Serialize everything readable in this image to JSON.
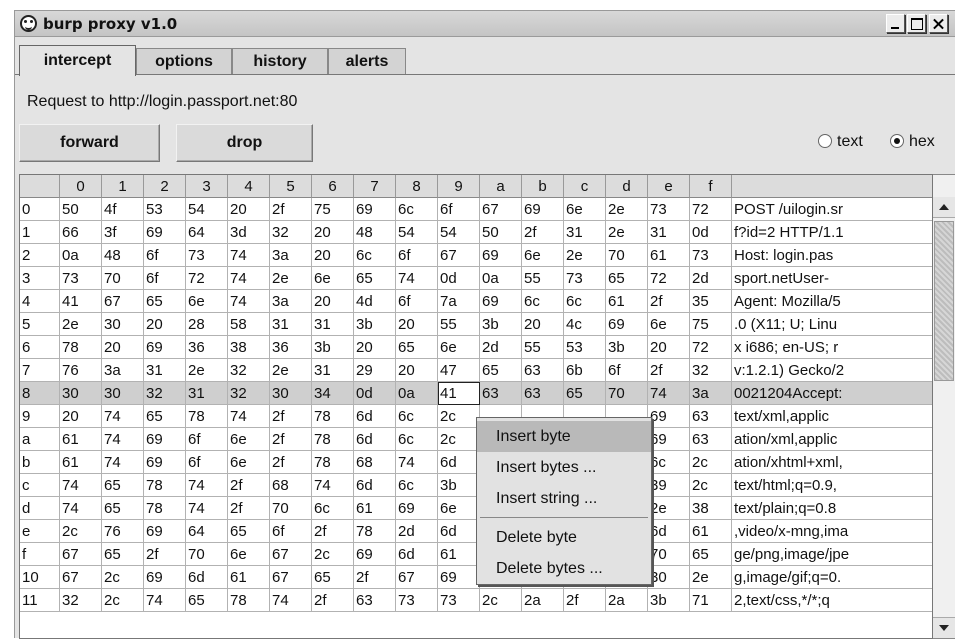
{
  "window": {
    "title": "burp proxy v1.0"
  },
  "tabs": [
    {
      "label": "intercept",
      "active": true
    },
    {
      "label": "options",
      "active": false
    },
    {
      "label": "history",
      "active": false
    },
    {
      "label": "alerts",
      "active": false
    }
  ],
  "request_label": "Request to http://login.passport.net:80",
  "buttons": {
    "forward": "forward",
    "drop": "drop"
  },
  "view_mode": {
    "text_label": "text",
    "hex_label": "hex",
    "selected": "hex"
  },
  "grid": {
    "columns": [
      "",
      "0",
      "1",
      "2",
      "3",
      "4",
      "5",
      "6",
      "7",
      "8",
      "9",
      "a",
      "b",
      "c",
      "d",
      "e",
      "f",
      ""
    ],
    "selected_row": "8",
    "focused_cell": {
      "row": "8",
      "col": "9"
    },
    "rows": [
      {
        "offset": "0",
        "bytes": [
          "50",
          "4f",
          "53",
          "54",
          "20",
          "2f",
          "75",
          "69",
          "6c",
          "6f",
          "67",
          "69",
          "6e",
          "2e",
          "73",
          "72"
        ],
        "text": "POST /uilogin.sr"
      },
      {
        "offset": "1",
        "bytes": [
          "66",
          "3f",
          "69",
          "64",
          "3d",
          "32",
          "20",
          "48",
          "54",
          "54",
          "50",
          "2f",
          "31",
          "2e",
          "31",
          "0d"
        ],
        "text": "f?id=2 HTTP/1.1"
      },
      {
        "offset": "2",
        "bytes": [
          "0a",
          "48",
          "6f",
          "73",
          "74",
          "3a",
          "20",
          "6c",
          "6f",
          "67",
          "69",
          "6e",
          "2e",
          "70",
          "61",
          "73"
        ],
        "text": "Host: login.pas"
      },
      {
        "offset": "3",
        "bytes": [
          "73",
          "70",
          "6f",
          "72",
          "74",
          "2e",
          "6e",
          "65",
          "74",
          "0d",
          "0a",
          "55",
          "73",
          "65",
          "72",
          "2d"
        ],
        "text": "sport.netUser-"
      },
      {
        "offset": "4",
        "bytes": [
          "41",
          "67",
          "65",
          "6e",
          "74",
          "3a",
          "20",
          "4d",
          "6f",
          "7a",
          "69",
          "6c",
          "6c",
          "61",
          "2f",
          "35"
        ],
        "text": "Agent: Mozilla/5"
      },
      {
        "offset": "5",
        "bytes": [
          "2e",
          "30",
          "20",
          "28",
          "58",
          "31",
          "31",
          "3b",
          "20",
          "55",
          "3b",
          "20",
          "4c",
          "69",
          "6e",
          "75"
        ],
        "text": ".0 (X11; U; Linu"
      },
      {
        "offset": "6",
        "bytes": [
          "78",
          "20",
          "69",
          "36",
          "38",
          "36",
          "3b",
          "20",
          "65",
          "6e",
          "2d",
          "55",
          "53",
          "3b",
          "20",
          "72"
        ],
        "text": "x i686; en-US; r"
      },
      {
        "offset": "7",
        "bytes": [
          "76",
          "3a",
          "31",
          "2e",
          "32",
          "2e",
          "31",
          "29",
          "20",
          "47",
          "65",
          "63",
          "6b",
          "6f",
          "2f",
          "32"
        ],
        "text": "v:1.2.1) Gecko/2"
      },
      {
        "offset": "8",
        "bytes": [
          "30",
          "30",
          "32",
          "31",
          "32",
          "30",
          "34",
          "0d",
          "0a",
          "41",
          "63",
          "63",
          "65",
          "70",
          "74",
          "3a"
        ],
        "text": "0021204Accept:"
      },
      {
        "offset": "9",
        "bytes": [
          "20",
          "74",
          "65",
          "78",
          "74",
          "2f",
          "78",
          "6d",
          "6c",
          "2c",
          "",
          "",
          "",
          "",
          "69",
          "63"
        ],
        "text": " text/xml,applic"
      },
      {
        "offset": "a",
        "bytes": [
          "61",
          "74",
          "69",
          "6f",
          "6e",
          "2f",
          "78",
          "6d",
          "6c",
          "2c",
          "",
          "",
          "",
          "",
          "69",
          "63"
        ],
        "text": "ation/xml,applic"
      },
      {
        "offset": "b",
        "bytes": [
          "61",
          "74",
          "69",
          "6f",
          "6e",
          "2f",
          "78",
          "68",
          "74",
          "6d",
          "",
          "",
          "",
          "",
          "6c",
          "2c"
        ],
        "text": "ation/xhtml+xml,"
      },
      {
        "offset": "c",
        "bytes": [
          "74",
          "65",
          "78",
          "74",
          "2f",
          "68",
          "74",
          "6d",
          "6c",
          "3b",
          "",
          "",
          "",
          "",
          "39",
          "2c"
        ],
        "text": "text/html;q=0.9,"
      },
      {
        "offset": "d",
        "bytes": [
          "74",
          "65",
          "78",
          "74",
          "2f",
          "70",
          "6c",
          "61",
          "69",
          "6e",
          "",
          "",
          "",
          "",
          "2e",
          "38"
        ],
        "text": "text/plain;q=0.8"
      },
      {
        "offset": "e",
        "bytes": [
          "2c",
          "76",
          "69",
          "64",
          "65",
          "6f",
          "2f",
          "78",
          "2d",
          "6d",
          "",
          "",
          "",
          "",
          "6d",
          "61"
        ],
        "text": ",video/x-mng,ima"
      },
      {
        "offset": "f",
        "bytes": [
          "67",
          "65",
          "2f",
          "70",
          "6e",
          "67",
          "2c",
          "69",
          "6d",
          "61",
          "",
          "",
          "",
          "",
          "70",
          "65"
        ],
        "text": "ge/png,image/jpe"
      },
      {
        "offset": "10",
        "bytes": [
          "67",
          "2c",
          "69",
          "6d",
          "61",
          "67",
          "65",
          "2f",
          "67",
          "69",
          "66",
          "3b",
          "71",
          "3d",
          "30",
          "2e"
        ],
        "text": "g,image/gif;q=0."
      },
      {
        "offset": "11",
        "bytes": [
          "32",
          "2c",
          "74",
          "65",
          "78",
          "74",
          "2f",
          "63",
          "73",
          "73",
          "2c",
          "2a",
          "2f",
          "2a",
          "3b",
          "71"
        ],
        "text": "2,text/css,*/*;q"
      }
    ]
  },
  "context_menu": {
    "items": [
      "Insert byte",
      "Insert bytes ...",
      "Insert string ...",
      "Delete byte",
      "Delete bytes ..."
    ],
    "highlighted": "Insert byte"
  }
}
